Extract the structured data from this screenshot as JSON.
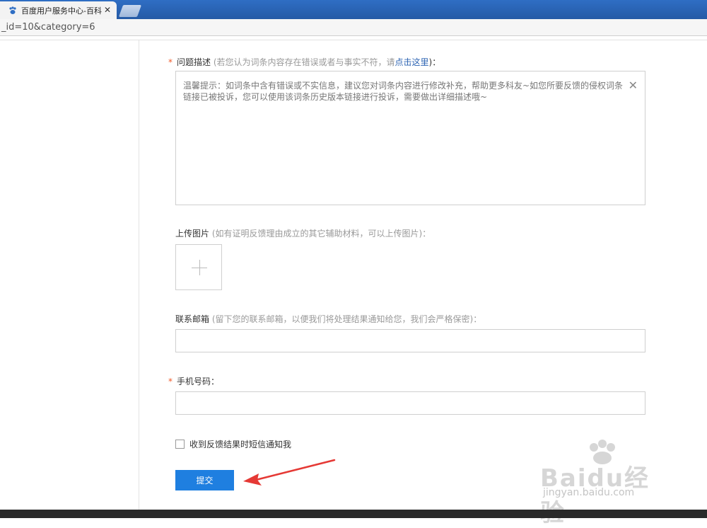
{
  "browser": {
    "tab_title": "百度用户服务中心-百科",
    "tab_close": "✕",
    "url_text": "_id=10&category=6"
  },
  "form": {
    "problem": {
      "required_mark": "*",
      "label": "问题描述",
      "hint_prefix": " (若您认为词条内容存在错误或者与事实不符，请",
      "hint_link": "点击这里",
      "hint_suffix": ")：",
      "tip": "温馨提示：如词条中含有错误或不实信息，建议您对词条内容进行修改补充，帮助更多科友~如您所要反馈的侵权词条链接已被投诉，您可以使用该词条历史版本链接进行投诉，需要做出详细描述哦~",
      "close_glyph": "✕"
    },
    "upload": {
      "label": "上传图片",
      "hint": " (如有证明反馈理由成立的其它辅助材料，可以上传图片)："
    },
    "email": {
      "label": "联系邮箱",
      "hint": " (留下您的联系邮箱，以便我们将处理结果通知给您，我们会严格保密)：",
      "value": ""
    },
    "phone": {
      "required_mark": "*",
      "label": "手机号码：",
      "value": ""
    },
    "sms_checkbox": {
      "label": "收到反馈结果时短信通知我",
      "checked": false
    },
    "submit_label": "提交"
  },
  "watermark": {
    "brand": "Baidu经验",
    "sub": "jingyan.baidu.com"
  },
  "colors": {
    "accent": "#1f7fe0",
    "required": "#f05a28",
    "link": "#2d64b3",
    "annotation_arrow": "#e53935"
  }
}
